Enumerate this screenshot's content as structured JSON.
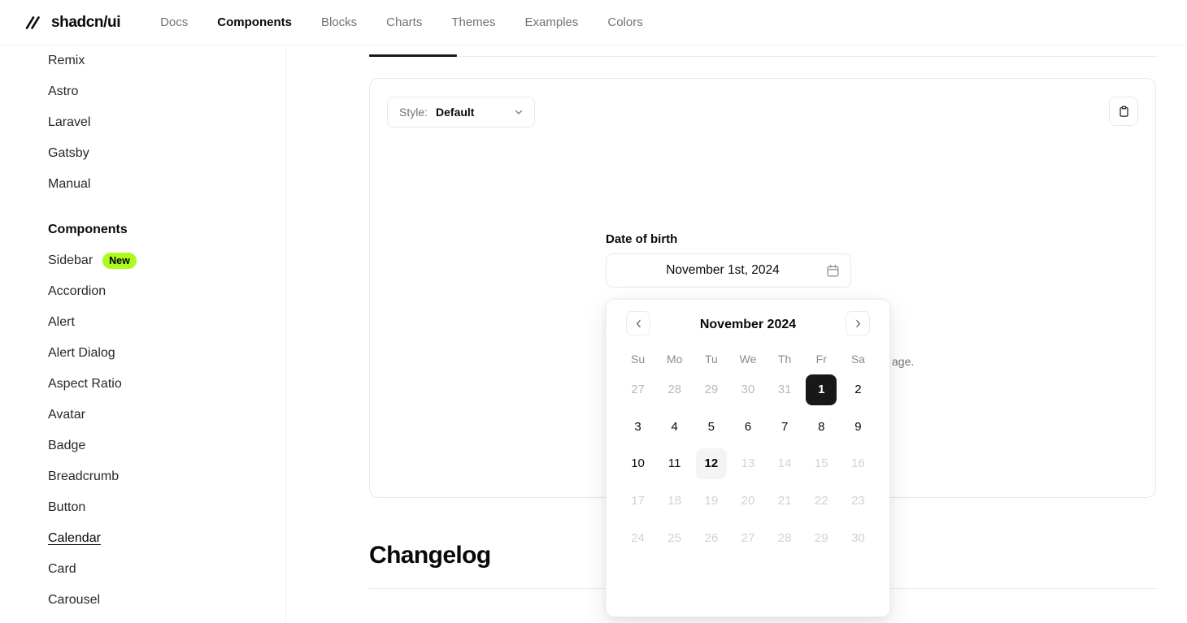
{
  "header": {
    "brand": "shadcn/ui",
    "logo_icon": "double-slash-logo-icon",
    "nav": [
      {
        "label": "Docs",
        "active": false
      },
      {
        "label": "Components",
        "active": true
      },
      {
        "label": "Blocks",
        "active": false
      },
      {
        "label": "Charts",
        "active": false
      },
      {
        "label": "Themes",
        "active": false
      },
      {
        "label": "Examples",
        "active": false
      },
      {
        "label": "Colors",
        "active": false
      }
    ]
  },
  "sidebar": {
    "items": [
      {
        "label": "Remix",
        "type": "link"
      },
      {
        "label": "Astro",
        "type": "link"
      },
      {
        "label": "Laravel",
        "type": "link"
      },
      {
        "label": "Gatsby",
        "type": "link"
      },
      {
        "label": "Manual",
        "type": "link"
      }
    ],
    "section_heading": "Components",
    "component_items": [
      {
        "label": "Sidebar",
        "badge": "New",
        "current": false
      },
      {
        "label": "Accordion",
        "badge": null,
        "current": false
      },
      {
        "label": "Alert",
        "badge": null,
        "current": false
      },
      {
        "label": "Alert Dialog",
        "badge": null,
        "current": false
      },
      {
        "label": "Aspect Ratio",
        "badge": null,
        "current": false
      },
      {
        "label": "Avatar",
        "badge": null,
        "current": false
      },
      {
        "label": "Badge",
        "badge": null,
        "current": false
      },
      {
        "label": "Breadcrumb",
        "badge": null,
        "current": false
      },
      {
        "label": "Button",
        "badge": null,
        "current": false
      },
      {
        "label": "Calendar",
        "badge": null,
        "current": true
      },
      {
        "label": "Card",
        "badge": null,
        "current": false
      },
      {
        "label": "Carousel",
        "badge": null,
        "current": false
      }
    ]
  },
  "main": {
    "style_selector": {
      "label": "Style:",
      "value": "Default",
      "chevron_icon": "chevron-down-icon"
    },
    "copy_button_icon": "clipboard-copy-icon",
    "form_description": "age.",
    "changelog_title": "Changelog"
  },
  "datefield": {
    "label": "Date of birth",
    "value": "November 1st, 2024",
    "icon": "calendar-icon"
  },
  "calendar": {
    "title": "November 2024",
    "prev_icon": "chevron-left-icon",
    "next_icon": "chevron-right-icon",
    "weekdays": [
      "Su",
      "Mo",
      "Tu",
      "We",
      "Th",
      "Fr",
      "Sa"
    ],
    "weeks": [
      [
        {
          "day": "27",
          "state": "outside"
        },
        {
          "day": "28",
          "state": "outside"
        },
        {
          "day": "29",
          "state": "outside"
        },
        {
          "day": "30",
          "state": "outside"
        },
        {
          "day": "31",
          "state": "outside"
        },
        {
          "day": "1",
          "state": "selected"
        },
        {
          "day": "2",
          "state": "normal"
        }
      ],
      [
        {
          "day": "3",
          "state": "normal"
        },
        {
          "day": "4",
          "state": "normal"
        },
        {
          "day": "5",
          "state": "normal"
        },
        {
          "day": "6",
          "state": "normal"
        },
        {
          "day": "7",
          "state": "normal"
        },
        {
          "day": "8",
          "state": "normal"
        },
        {
          "day": "9",
          "state": "normal"
        }
      ],
      [
        {
          "day": "10",
          "state": "normal"
        },
        {
          "day": "11",
          "state": "normal"
        },
        {
          "day": "12",
          "state": "today"
        },
        {
          "day": "13",
          "state": "disabled"
        },
        {
          "day": "14",
          "state": "disabled"
        },
        {
          "day": "15",
          "state": "disabled"
        },
        {
          "day": "16",
          "state": "disabled"
        }
      ],
      [
        {
          "day": "17",
          "state": "disabled"
        },
        {
          "day": "18",
          "state": "disabled"
        },
        {
          "day": "19",
          "state": "disabled"
        },
        {
          "day": "20",
          "state": "disabled"
        },
        {
          "day": "21",
          "state": "disabled"
        },
        {
          "day": "22",
          "state": "disabled"
        },
        {
          "day": "23",
          "state": "disabled"
        }
      ],
      [
        {
          "day": "24",
          "state": "disabled"
        },
        {
          "day": "25",
          "state": "disabled"
        },
        {
          "day": "26",
          "state": "disabled"
        },
        {
          "day": "27",
          "state": "disabled"
        },
        {
          "day": "28",
          "state": "disabled"
        },
        {
          "day": "29",
          "state": "disabled"
        },
        {
          "day": "30",
          "state": "disabled"
        }
      ]
    ]
  },
  "colors": {
    "accent_badge": "#adfa1d",
    "selected_day": "#18181b",
    "today_bg": "#f4f4f5",
    "muted_text": "#71717a",
    "border": "#e9e9ec"
  }
}
